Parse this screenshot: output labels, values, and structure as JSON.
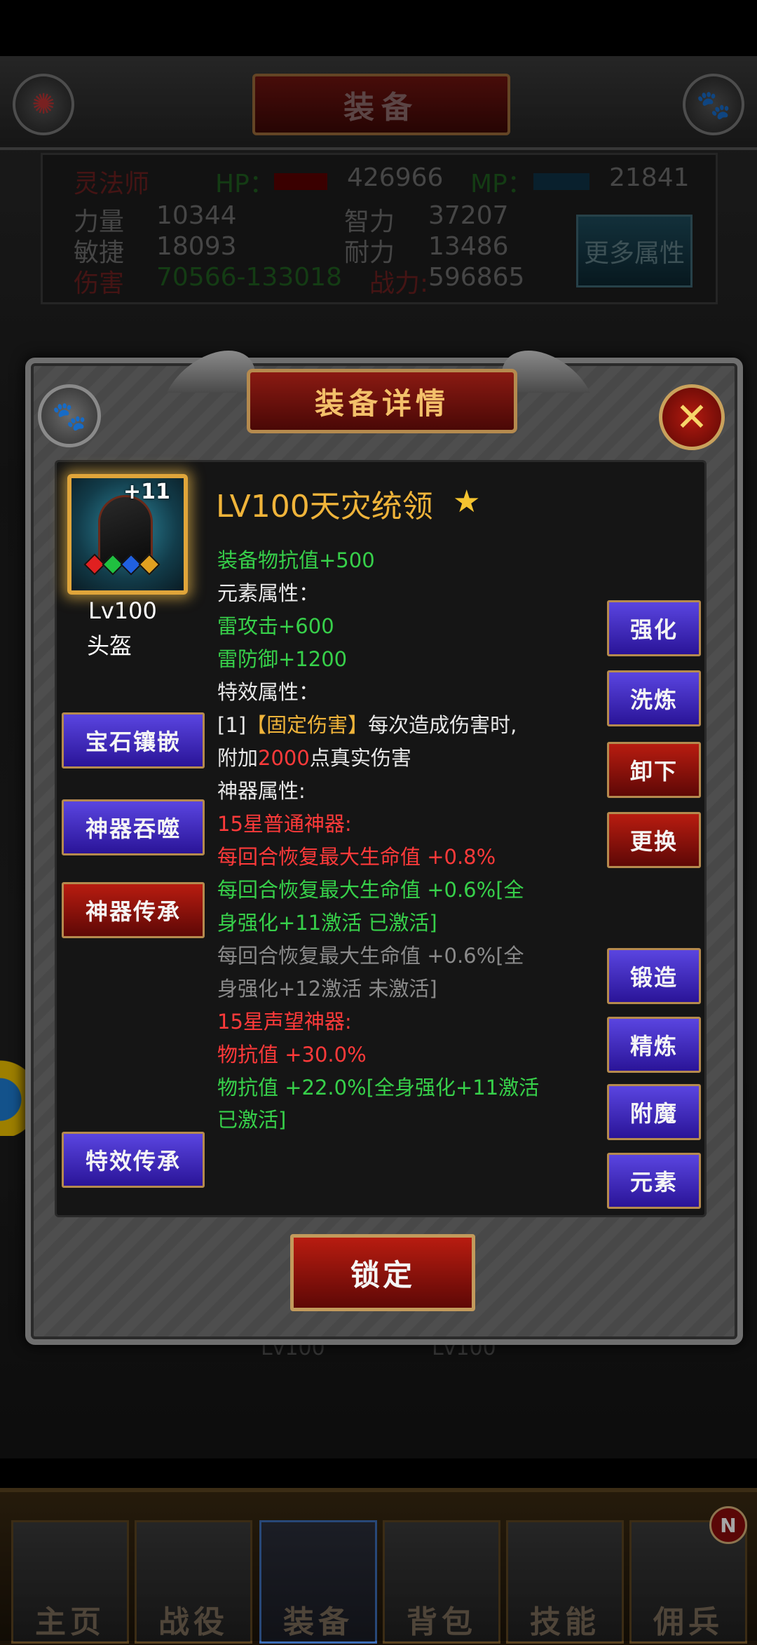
{
  "header": {
    "title": "装备"
  },
  "stats": {
    "class": "灵法师",
    "hp_label": "HP：",
    "hp_value": "426966",
    "mp_label": "MP：",
    "mp_value": "21841",
    "str_label": "力量",
    "str_value": "10344",
    "int_label": "智力",
    "int_value": "37207",
    "agi_label": "敏捷",
    "agi_value": "18093",
    "end_label": "耐力",
    "end_value": "13486",
    "dmg_label": "伤害",
    "dmg_value": "70566-133018",
    "power_label": "战力:",
    "power_value": "596865",
    "more_button": "更多属性"
  },
  "background_levels": [
    "Lv100",
    "Lv100"
  ],
  "modal": {
    "title": "装备详情",
    "item": {
      "plus": "+11",
      "level_short": "Lv100",
      "type": "头盔",
      "name": "LV100天灾统领",
      "gems": [
        "#e02020",
        "#20c040",
        "#2060e0",
        "#e0a020"
      ]
    },
    "lines": [
      {
        "text": "装备物抗值+500",
        "color": "green"
      },
      {
        "text": "元素属性：",
        "color": "white"
      },
      {
        "text": "雷攻击+600",
        "color": "green"
      },
      {
        "text": "雷防御+1200",
        "color": "green"
      },
      {
        "text": "特效属性：",
        "color": "white"
      },
      {
        "text": "[1]【固定伤害】每次造成伤害时,",
        "color": "white"
      },
      {
        "text": "附加2000点真实伤害",
        "color": "white"
      },
      {
        "text": "神器属性:",
        "color": "white"
      },
      {
        "text": "15星普通神器:",
        "color": "red"
      },
      {
        "text": "每回合恢复最大生命值 +0.8%",
        "color": "red"
      },
      {
        "text": "每回合恢复最大生命值 +0.6%[全",
        "color": "green"
      },
      {
        "text": "身强化+11激活 已激活]",
        "color": "green"
      },
      {
        "text": "每回合恢复最大生命值 +0.6%[全",
        "color": "grey"
      },
      {
        "text": "身强化+12激活 未激活]",
        "color": "grey"
      },
      {
        "text": "15星声望神器:",
        "color": "red"
      },
      {
        "text": "物抗值 +30.0%",
        "color": "red"
      },
      {
        "text": "物抗值 +22.0%[全身强化+11激活",
        "color": "green"
      },
      {
        "text": "已激活]",
        "color": "green"
      }
    ],
    "left_buttons": {
      "gem": "宝石镶嵌",
      "devour": "神器吞噬",
      "inherit": "神器传承",
      "effect_inherit": "特效传承"
    },
    "right_buttons": {
      "enhance": "强化",
      "refine_wash": "洗炼",
      "unequip": "卸下",
      "replace": "更换",
      "forge": "锻造",
      "refine": "精炼",
      "enchant": "附魔",
      "element": "元素"
    },
    "lock_button": "锁定"
  },
  "nav": {
    "items": [
      "主页",
      "战役",
      "装备",
      "背包",
      "技能",
      "佣兵"
    ],
    "active": 2,
    "badge": "N"
  }
}
